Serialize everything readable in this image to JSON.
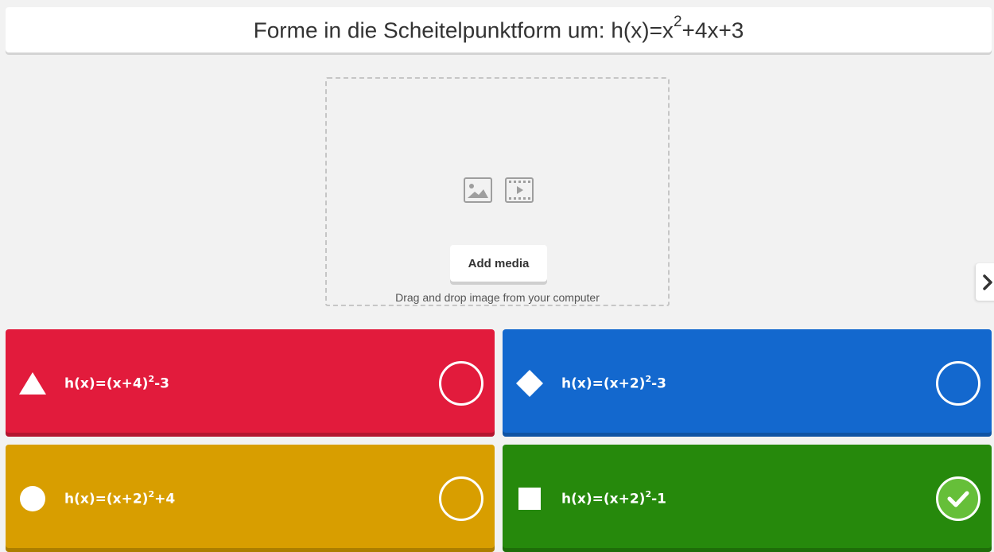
{
  "question": {
    "text_prefix": "Forme in die Scheitelpunktform um: h(x)=x",
    "sup": "2",
    "text_suffix": "+4x+3"
  },
  "media": {
    "add_label": "Add media",
    "hint": "Drag and drop image from your computer",
    "icons": [
      "image-icon",
      "video-icon"
    ]
  },
  "navigation": {
    "next_icon": "chevron-right-icon"
  },
  "answers": [
    {
      "shape": "triangle",
      "color": "#e21b3c",
      "prefix": "h(x)=(x+4)",
      "sup": "2",
      "suffix": "-3",
      "correct": false
    },
    {
      "shape": "diamond",
      "color": "#1368ce",
      "prefix": "h(x)=(x+2)",
      "sup": "2",
      "suffix": "-3",
      "correct": false
    },
    {
      "shape": "circle",
      "color": "#d89e00",
      "prefix": "h(x)=(x+2)",
      "sup": "2",
      "suffix": "+4",
      "correct": false
    },
    {
      "shape": "square",
      "color": "#26890c",
      "prefix": "h(x)=(x+2)",
      "sup": "2",
      "suffix": "-1",
      "correct": true
    }
  ]
}
